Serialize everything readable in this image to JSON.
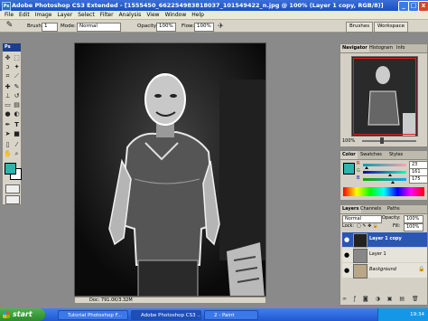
{
  "window": {
    "title": "Adobe Photoshop CS3 Extended - [1555450_662254983818037_101549422_n.jpg @ 100% (Layer 1 copy, RGB/8)]",
    "app_icon": "Ps",
    "minimize": "_",
    "maximize": "□",
    "close": "x"
  },
  "menu": [
    "File",
    "Edit",
    "Image",
    "Layer",
    "Select",
    "Filter",
    "Analysis",
    "View",
    "Window",
    "Help"
  ],
  "options": {
    "brush_label": "Brush:",
    "brush_size": "1",
    "mode_label": "Mode:",
    "mode_value": "Normal",
    "opacity_label": "Opacity:",
    "opacity_value": "100%",
    "flow_label": "Flow:",
    "flow_value": "100%",
    "brushes_btn": "Brushes",
    "workspace_btn": "Workspace"
  },
  "toolbox": {
    "header": "Ps",
    "tools": [
      "move-icon",
      "marquee-icon",
      "lasso-icon",
      "magic-wand-icon",
      "crop-icon",
      "slice-icon",
      "healing-icon",
      "brush-icon",
      "stamp-icon",
      "history-brush-icon",
      "eraser-icon",
      "gradient-icon",
      "blur-icon",
      "dodge-icon",
      "pen-icon",
      "type-icon",
      "path-select-icon",
      "shape-icon",
      "notes-icon",
      "eyedropper-icon",
      "hand-icon",
      "zoom-icon"
    ],
    "fg_color": "#2fb3ad",
    "bg_color": "#ffffff"
  },
  "document": {
    "status": "Doc: 791.0K/3.32M"
  },
  "navigator": {
    "tabs": [
      "Navigator",
      "Histogram",
      "Info"
    ],
    "zoom": "100%"
  },
  "color": {
    "tabs": [
      "Color",
      "Swatches",
      "Styles"
    ],
    "r_label": "R",
    "g_label": "G",
    "b_label": "B",
    "r": "23",
    "g": "161",
    "b": "175",
    "r_level": 0.09,
    "g_level": 0.63,
    "b_level": 0.69
  },
  "layers": {
    "tabs": [
      "Layers",
      "Channels",
      "Paths"
    ],
    "blend_mode": "Normal",
    "opacity_label": "Opacity:",
    "opacity": "100%",
    "lock_label": "Lock:",
    "fill_label": "Fill:",
    "fill": "100%",
    "items": [
      {
        "name": "Layer 1 copy",
        "selected": true
      },
      {
        "name": "Layer 1",
        "selected": false
      },
      {
        "name": "Background",
        "selected": false
      }
    ]
  },
  "taskbar": {
    "start": "start",
    "tasks": [
      "Tutorial Photoshop F...",
      "Adobe Photoshop CS3 ...",
      "2 - Paint"
    ],
    "clock": "19:34"
  }
}
